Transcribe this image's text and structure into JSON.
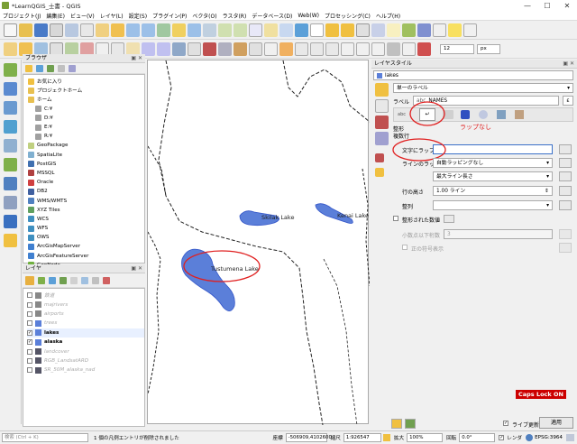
{
  "window": {
    "title": "*LearnQGIS_士書 - QGIS",
    "minimize": "—",
    "maximize": "☐",
    "close": "✕"
  },
  "menu": [
    "プロジェクト(J)",
    "編集(E)",
    "ビュー(V)",
    "レイヤ(L)",
    "設定(S)",
    "プラグイン(P)",
    "ベクタ(O)",
    "ラスタ(R)",
    "データベース(D)",
    "Web(W)",
    "プロセッシング(C)",
    "ヘルプ(H)"
  ],
  "toolbar": {
    "font_size_value": "12",
    "font_unit": "px"
  },
  "browser": {
    "title": "ブラウザ",
    "items": [
      {
        "label": "お気に入り",
        "icon": "star-icon"
      },
      {
        "label": "プロジェクトホーム",
        "icon": "folder-icon"
      },
      {
        "label": "ホーム",
        "icon": "folder-icon"
      },
      {
        "label": "C:¥",
        "icon": "drive-icon"
      },
      {
        "label": "D:¥",
        "icon": "drive-icon"
      },
      {
        "label": "E:¥",
        "icon": "drive-icon"
      },
      {
        "label": "R:¥",
        "icon": "drive-icon"
      },
      {
        "label": "GeoPackage",
        "icon": "geopackage-icon"
      },
      {
        "label": "SpatiaLite",
        "icon": "spatialite-icon"
      },
      {
        "label": "PostGIS",
        "icon": "postgis-icon"
      },
      {
        "label": "MSSQL",
        "icon": "mssql-icon"
      },
      {
        "label": "Oracle",
        "icon": "oracle-icon"
      },
      {
        "label": "DB2",
        "icon": "db2-icon"
      },
      {
        "label": "WMS/WMTS",
        "icon": "wms-icon"
      },
      {
        "label": "XYZ Tiles",
        "icon": "xyz-icon"
      },
      {
        "label": "WCS",
        "icon": "wcs-icon"
      },
      {
        "label": "WFS",
        "icon": "wfs-icon"
      },
      {
        "label": "OWS",
        "icon": "ows-icon"
      },
      {
        "label": "ArcGisMapServer",
        "icon": "arcgis-icon"
      },
      {
        "label": "ArcGisFeatureServer",
        "icon": "arcgis-icon"
      },
      {
        "label": "GeoNode",
        "icon": "geonode-icon"
      }
    ]
  },
  "layers": {
    "title": "レイヤ",
    "items": [
      {
        "label": "鉄道",
        "checked": false,
        "dim": true,
        "icon": "line-layer-icon"
      },
      {
        "label": "majrivers",
        "checked": false,
        "dim": true,
        "icon": "line-layer-icon"
      },
      {
        "label": "airports",
        "checked": false,
        "dim": true,
        "icon": "point-layer-icon"
      },
      {
        "label": "trees",
        "checked": false,
        "dim": true,
        "icon": "polygon-layer-icon"
      },
      {
        "label": "lakes",
        "checked": true,
        "dim": false,
        "icon": "polygon-layer-icon"
      },
      {
        "label": "alaska",
        "checked": true,
        "dim": false,
        "icon": "polygon-layer-icon"
      },
      {
        "label": "landcover",
        "checked": false,
        "dim": true,
        "icon": "raster-layer-icon"
      },
      {
        "label": "RGB_LandsatARD",
        "checked": false,
        "dim": true,
        "icon": "raster-layer-icon"
      },
      {
        "label": "SR_50M_alaska_nad",
        "checked": false,
        "dim": true,
        "icon": "raster-layer-icon"
      }
    ]
  },
  "map": {
    "labels": [
      "Skilak Lake",
      "Kenai Lake",
      "Tustumena Lake"
    ]
  },
  "style_panel": {
    "title": "レイヤスタイル",
    "layer": "lakes",
    "renderer": "単一のラベル",
    "label_with_prefix": "ラベル",
    "label_field": "NAMES",
    "annotation": "ラップなし",
    "section_format": "整形",
    "section_wrap": "複数行",
    "wrap_on_char_label": "文字にラップ",
    "wrap_on_char_value": "",
    "line_wrap_label": "ラインのラップ",
    "line_wrap_value": "自動ラッピングなし",
    "max_line_length": "最大ライン長さ",
    "line_height_label": "行の高さ",
    "line_height_value": "1.00 ライン",
    "alignment_label": "整列",
    "alignment_value": "",
    "formatted_numbers_label": "整形された数値",
    "decimal_places_label": "小数点以下桁数",
    "decimal_places_value": "3",
    "plus_sign_label": "正の符号表示",
    "caps_lock": "Caps Lock ON",
    "live_update": "ライブ更新",
    "apply": "適用"
  },
  "statusbar": {
    "search_placeholder": "検索 (Ctrl + K)",
    "message": "1 個の凡例エントリが削除されました",
    "coord_label": "座標",
    "coord_value": "-506909,4102600",
    "scale_label": "縮尺",
    "scale_value": "1:926547",
    "magnifier_label": "拡大",
    "magnifier_value": "100%",
    "rotation_label": "回転",
    "rotation_value": "0.0°",
    "render_label": "レンダ",
    "crs": "EPSG:3964"
  },
  "colors": {
    "lake_fill": "#5b7fd9",
    "lake_stroke": "#3355c8",
    "annotation_red": "#e02020",
    "qgis_green": "#7a9f35"
  }
}
